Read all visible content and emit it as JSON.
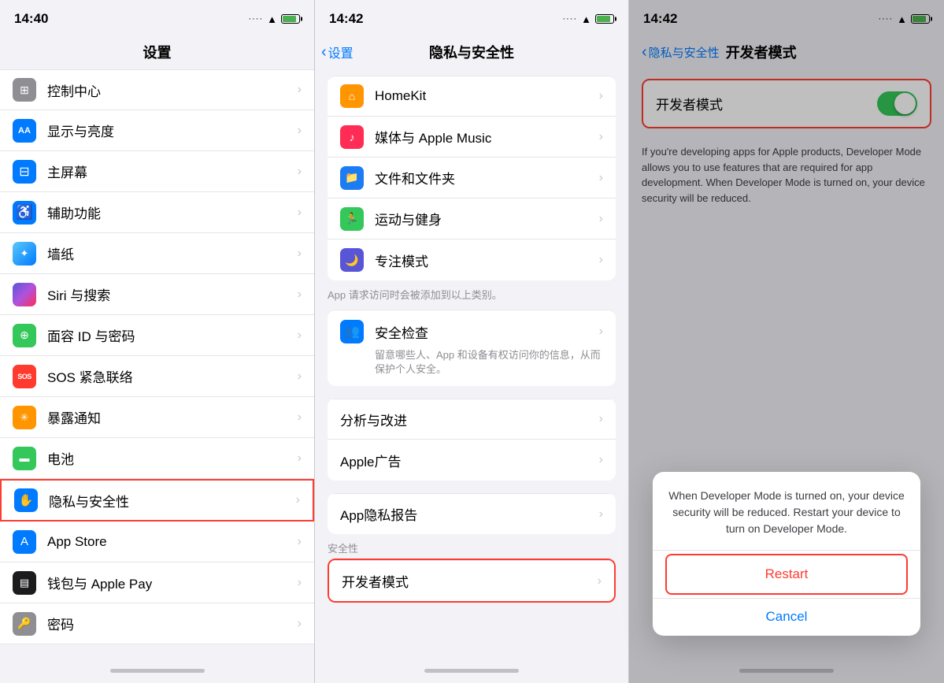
{
  "panel1": {
    "status": {
      "time": "14:40"
    },
    "title": "设置",
    "items": [
      {
        "id": "control-center",
        "label": "控制中心",
        "iconBg": "icon-gray",
        "iconText": "⊞"
      },
      {
        "id": "display",
        "label": "显示与亮度",
        "iconBg": "icon-blue-aa",
        "iconText": "AA"
      },
      {
        "id": "home-screen",
        "label": "主屏幕",
        "iconBg": "icon-blue-grid",
        "iconText": "⊞"
      },
      {
        "id": "accessibility",
        "label": "辅助功能",
        "iconBg": "icon-blue-acc",
        "iconText": "♿"
      },
      {
        "id": "wallpaper",
        "label": "墙纸",
        "iconBg": "icon-teal",
        "iconText": "✦"
      },
      {
        "id": "siri",
        "label": "Siri 与搜索",
        "iconBg": "icon-purple",
        "iconText": "◉"
      },
      {
        "id": "face-id",
        "label": "面容 ID 与密码",
        "iconBg": "icon-green",
        "iconText": "⊕"
      },
      {
        "id": "sos",
        "label": "SOS 紧急联络",
        "iconBg": "icon-sos",
        "iconText": "SOS"
      },
      {
        "id": "exposure",
        "label": "暴露通知",
        "iconBg": "icon-exposure",
        "iconText": "✳"
      },
      {
        "id": "battery",
        "label": "电池",
        "iconBg": "icon-battery",
        "iconText": "▬"
      },
      {
        "id": "privacy",
        "label": "隐私与安全性",
        "iconBg": "icon-privacy",
        "iconText": "✋"
      },
      {
        "id": "appstore",
        "label": "App Store",
        "iconBg": "icon-appstore",
        "iconText": "A"
      },
      {
        "id": "wallet",
        "label": "钱包与 Apple Pay",
        "iconBg": "icon-wallet",
        "iconText": "▤"
      },
      {
        "id": "password",
        "label": "密码",
        "iconBg": "icon-password",
        "iconText": "🔑"
      }
    ]
  },
  "panel2": {
    "status": {
      "time": "14:42"
    },
    "nav": {
      "back": "设置",
      "title": "隐私与安全性"
    },
    "items": [
      {
        "id": "homekit",
        "label": "HomeKit",
        "iconBg": "#ff9500",
        "iconText": "⌂",
        "group": "main"
      },
      {
        "id": "apple-music",
        "label": "媒体与 Apple Music",
        "iconBg": "#ff2d55",
        "iconText": "♪",
        "group": "main"
      },
      {
        "id": "files",
        "label": "文件和文件夹",
        "iconBg": "#1c7cf4",
        "iconText": "📁",
        "group": "main"
      },
      {
        "id": "fitness",
        "label": "运动与健身",
        "iconBg": "#34c759",
        "iconText": "🏃",
        "group": "main"
      },
      {
        "id": "focus",
        "label": "专注模式",
        "iconBg": "#5856d6",
        "iconText": "🌙",
        "group": "main"
      }
    ],
    "sectionNote": "App 请求访问时会被添加到以上类别。",
    "safetyCheck": {
      "label": "安全检查",
      "note": "留意哪些人、App 和设备有权访问你的信息，从而保护个人安全。"
    },
    "analysisItems": [
      {
        "id": "analytics",
        "label": "分析与改进"
      },
      {
        "id": "apple-ads",
        "label": "Apple广告"
      }
    ],
    "privacyReport": {
      "label": "App隐私报告"
    },
    "securityHeader": "安全性",
    "devMode": {
      "label": "开发者模式",
      "highlighted": true
    }
  },
  "panel3": {
    "status": {
      "time": "14:42"
    },
    "nav": {
      "back": "隐私与安全性",
      "title": "开发者模式"
    },
    "devMode": {
      "label": "开发者模式",
      "enabled": true,
      "description": "If you're developing apps for Apple products, Developer Mode allows you to use features that are required for app development. When Developer Mode is turned on, your device security will be reduced."
    },
    "alert": {
      "message": "When Developer Mode is turned on, your device security will be reduced. Restart your device to turn on Developer Mode.",
      "restartLabel": "Restart",
      "cancelLabel": "Cancel"
    }
  },
  "icons": {
    "chevron": "›",
    "back_chevron": "‹",
    "wifi": "📶",
    "signal": "···"
  }
}
